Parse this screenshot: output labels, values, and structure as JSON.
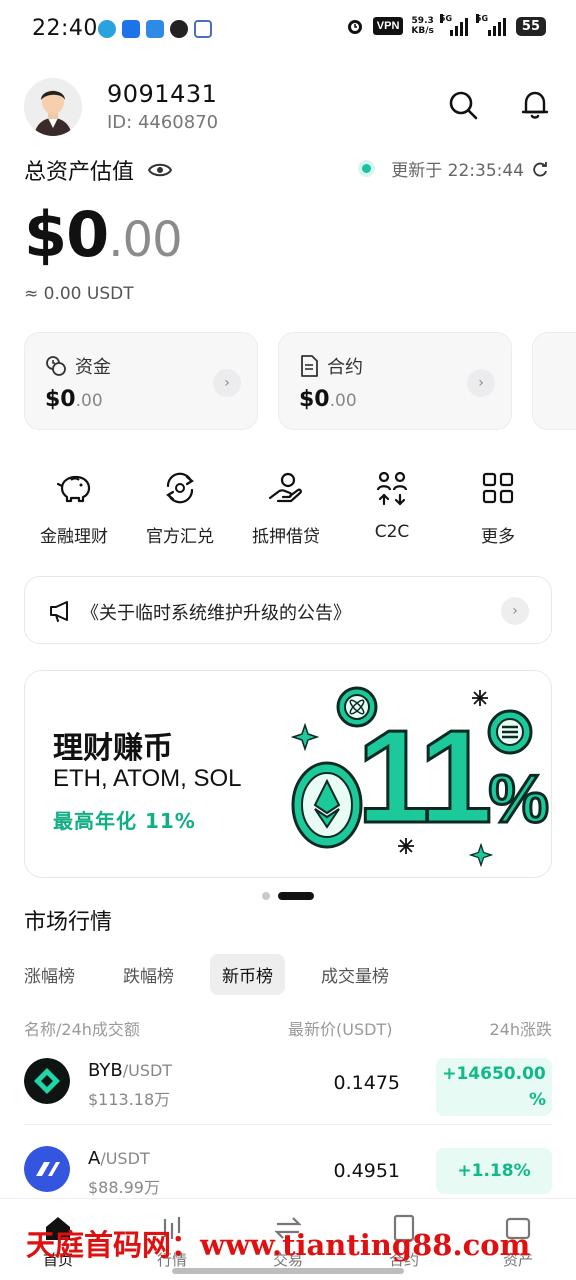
{
  "status_bar": {
    "time": "22:40",
    "vpn": "VPN",
    "speed_value": "59.3",
    "speed_unit": "KB/s",
    "net1": "5G",
    "net2": "5G",
    "battery": "55"
  },
  "header": {
    "user_id_main": "9091431",
    "user_id_label": "ID: 4460870"
  },
  "assets": {
    "title": "总资产估值",
    "updated_label": "更新于 22:35:44",
    "amount_int": "$0",
    "amount_dec": ".00",
    "usdt_equiv": "≈ 0.00 USDT",
    "cards": [
      {
        "label": "资金",
        "value_int": "$0",
        "value_dec": ".00"
      },
      {
        "label": "合约",
        "value_int": "$0",
        "value_dec": ".00"
      }
    ]
  },
  "quick_actions": [
    {
      "label": "金融理财",
      "icon": "piggy-bank-icon"
    },
    {
      "label": "官方汇兑",
      "icon": "exchange-icon"
    },
    {
      "label": "抵押借贷",
      "icon": "loan-hand-icon"
    },
    {
      "label": "C2C",
      "icon": "c2c-icon"
    },
    {
      "label": "更多",
      "icon": "grid-icon"
    }
  ],
  "announcement": {
    "text": "《关于临时系统维护升级的公告》"
  },
  "banner": {
    "title": "理财赚币",
    "subtitle": "ETH, ATOM, SOL",
    "promo": "最高年化 11%",
    "big_number": "11",
    "big_suffix": "%",
    "page_index": 2,
    "page_count": 2
  },
  "market": {
    "title": "市场行情",
    "tabs": [
      "涨幅榜",
      "跌幅榜",
      "新币榜",
      "成交量榜"
    ],
    "active_tab": "新币榜",
    "col_name": "名称/24h成交额",
    "col_price": "最新价(USDT)",
    "col_change": "24h涨跌",
    "rows": [
      {
        "base": "BYB",
        "quote": "/USDT",
        "volume": "$113.18万",
        "price": "0.1475",
        "change_line1": "+14650.00",
        "change_line2": "%"
      },
      {
        "base": "A",
        "quote": "/USDT",
        "volume": "$88.99万",
        "price": "0.4951",
        "change_line1": "+1.18%",
        "change_line2": ""
      }
    ]
  },
  "bottom_nav": {
    "items": [
      "首页",
      "行情",
      "交易",
      "合约",
      "资产"
    ],
    "active": "首页"
  },
  "watermark": "天庭首码网：www.tianting88.com",
  "colors": {
    "accent_green": "#10b988",
    "banner_green": "#1cc99a",
    "watermark_red": "#e01010"
  }
}
